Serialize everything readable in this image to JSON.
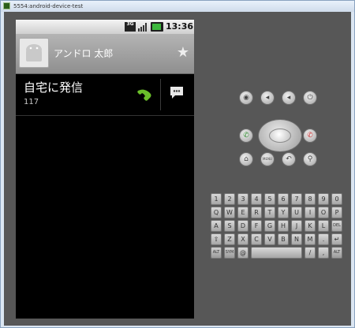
{
  "window": {
    "title": "5554:android-device-test"
  },
  "statusbar": {
    "network": "3G",
    "time": "13:36"
  },
  "contact": {
    "name": "アンドロ 太郎",
    "star_icon": "star-icon",
    "avatar_icon": "android-avatar-icon"
  },
  "call_row": {
    "label": "自宅に発信",
    "number": "117",
    "call_icon": "phone-call-icon",
    "sms_icon": "sms-icon"
  },
  "controls": {
    "row1": [
      "camera-icon",
      "volume-down-icon",
      "volume-up-icon",
      "power-icon"
    ],
    "row2": [
      "call-button-icon",
      "dpad-icon",
      "end-call-icon"
    ],
    "row3": [
      "home-icon",
      "menu",
      "back-icon",
      "search-icon"
    ],
    "menu_label": "MENU"
  },
  "keyboard": {
    "rows": [
      [
        "1",
        "2",
        "3",
        "4",
        "5",
        "6",
        "7",
        "8",
        "9",
        "0"
      ],
      [
        "Q",
        "W",
        "E",
        "R",
        "T",
        "Y",
        "U",
        "I",
        "O",
        "P"
      ],
      [
        "A",
        "S",
        "D",
        "F",
        "G",
        "H",
        "J",
        "K",
        "L",
        "DEL"
      ],
      [
        "⇧",
        "Z",
        "X",
        "C",
        "V",
        "B",
        "N",
        "M",
        ".",
        "↵"
      ],
      [
        "ALT",
        "SYM",
        "@",
        "",
        "/",
        ",",
        "ALT"
      ]
    ]
  },
  "colors": {
    "accent_green": "#3db83d",
    "call_green": "#6abf2a",
    "end_red": "#cc3333"
  }
}
